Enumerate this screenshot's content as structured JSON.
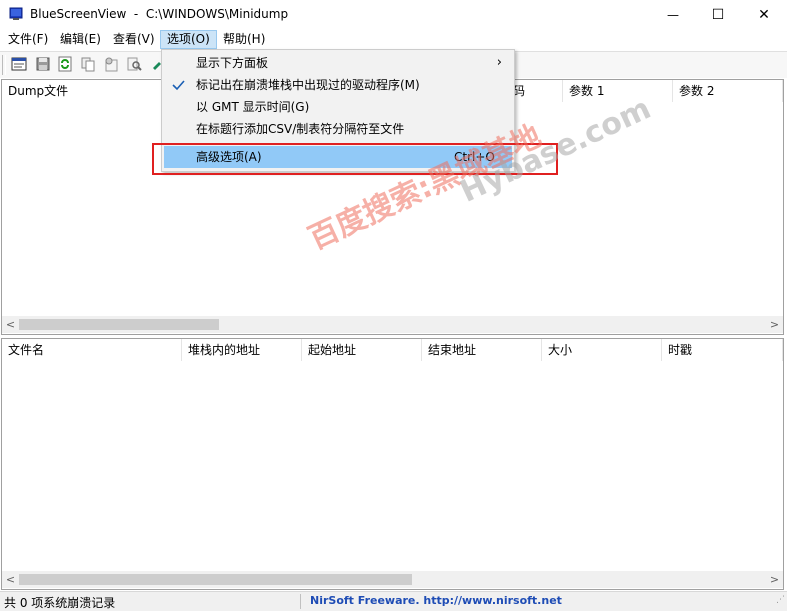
{
  "window": {
    "title": "BlueScreenView  -  C:\\WINDOWS\\Minidump",
    "minimize_symbol": "—",
    "maximize_symbol": "☐",
    "close_symbol": "✕"
  },
  "menubar": {
    "items": [
      {
        "label": "文件(F)"
      },
      {
        "label": "编辑(E)"
      },
      {
        "label": "查看(V)"
      },
      {
        "label": "选项(O)"
      },
      {
        "label": "帮助(H)"
      }
    ]
  },
  "toolbar": {
    "icons": [
      "properties-icon",
      "save-icon",
      "refresh-icon",
      "copy-icon",
      "html-report-icon",
      "find-icon",
      "pin-icon"
    ]
  },
  "upper_table": {
    "columns": [
      "Dump文件",
      "码",
      "参数 1",
      "参数 2"
    ]
  },
  "lower_table": {
    "columns": [
      "文件名",
      "堆栈内的地址",
      "起始地址",
      "结束地址",
      "大小",
      "时戳"
    ]
  },
  "dropdown": {
    "items": [
      {
        "label": "显示下方面板",
        "has_submenu": true
      },
      {
        "label": "标记出在崩溃堆栈中出现过的驱动程序(M)",
        "checked": true
      },
      {
        "label": "以 GMT 显示时间(G)"
      },
      {
        "label": "在标题行添加CSV/制表符分隔符至文件"
      },
      {
        "label": "高级选项(A)",
        "shortcut": "Ctrl+O",
        "highlighted": true
      }
    ]
  },
  "statusbar": {
    "record_count": "共 0 项系统崩溃记录",
    "link": "NirSoft Freeware.  http://www.nirsoft.net"
  },
  "watermark": {
    "line1": "百度搜索:黑域基地",
    "line2": "Hybase.com"
  },
  "colors": {
    "highlight": "#91c9f7",
    "menu_active": "#cce4f7",
    "annotation_red": "#e02020",
    "watermark_red": "#f07060",
    "watermark_gray": "#a8a8a8",
    "link_blue": "#1e4cb5"
  }
}
